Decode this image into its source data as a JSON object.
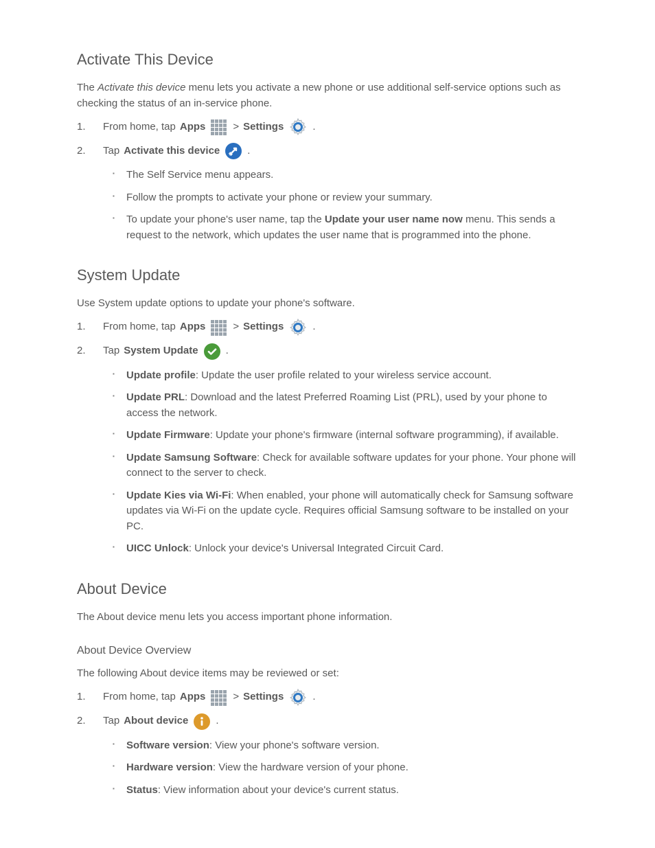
{
  "activate": {
    "heading": "Activate This Device",
    "desc_before": "The ",
    "desc_ital": "Activate this device",
    "desc_after": " menu lets you activate a new phone or use additional self-service options such as checking the status of an in-service phone.",
    "step1_a": "From home, tap ",
    "step1_apps": "Apps",
    "step1_b": " > ",
    "step1_settings": "Settings",
    "step1_c": ".",
    "step2_a": "Tap ",
    "step2_activate": "Activate this device",
    "step2_b": ".",
    "bullet1": "The Self Service menu appears.",
    "bullet2": "Follow the prompts to activate your phone or review your summary.",
    "bullet3": "To update your phone's user name, tap the ",
    "bullet3_bold": "Update your user name now",
    "bullet3_c": " menu. This sends a request to the network, which updates the user name that is programmed into the phone."
  },
  "sysupdate": {
    "heading": "System Update",
    "desc": "Use System update options to update your phone's software.",
    "step1_a": "From home, tap ",
    "step1_apps": "Apps",
    "step1_b": " > ",
    "step1_settings": "Settings",
    "step1_c": ".",
    "step2_a": "Tap ",
    "step2_label": "System Update",
    "step2_b": ".",
    "item1_bold": "Update profile",
    "item1_rest": ": Update the user profile related to your wireless service account.",
    "item2_bold": "Update PRL",
    "item2_rest": ": Download and the latest Preferred Roaming List (PRL), used by your phone to access the network.",
    "item3_bold": "Update Firmware",
    "item3_rest": ": Update your phone's firmware (internal software programming), if available.",
    "item4_bold": "Update Samsung Software",
    "item4_rest": ": Check for available software updates for your phone. Your phone will connect to the server to check.",
    "item5_bold": "Update Kies via Wi-Fi",
    "item5_rest": ": When enabled, your phone will automatically check for Samsung software updates via Wi-Fi on the update cycle. Requires official Samsung software to be installed on your PC.",
    "item6_bold": "UICC Unlock",
    "item6_rest": ": Unlock your device's Universal Integrated Circuit Card."
  },
  "about": {
    "heading": "About Device",
    "desc": "The About device menu lets you access important phone information.",
    "sub": "About Device Overview",
    "sub_desc": "The following About device items may be reviewed or set:",
    "step1_a": "From home, tap ",
    "step1_apps": "Apps",
    "step1_b": " > ",
    "step1_settings": "Settings",
    "step1_c": ".",
    "step2_a": "Tap ",
    "step2_label": "About device",
    "step2_b": ".",
    "item1_bold": "Software version",
    "item1_rest": ": View your phone's software version.",
    "item2_bold": "Hardware version",
    "item2_rest": ": View the hardware version of your phone.",
    "item3_bold": "Status",
    "item3_rest": ": View information about your device's current status."
  }
}
